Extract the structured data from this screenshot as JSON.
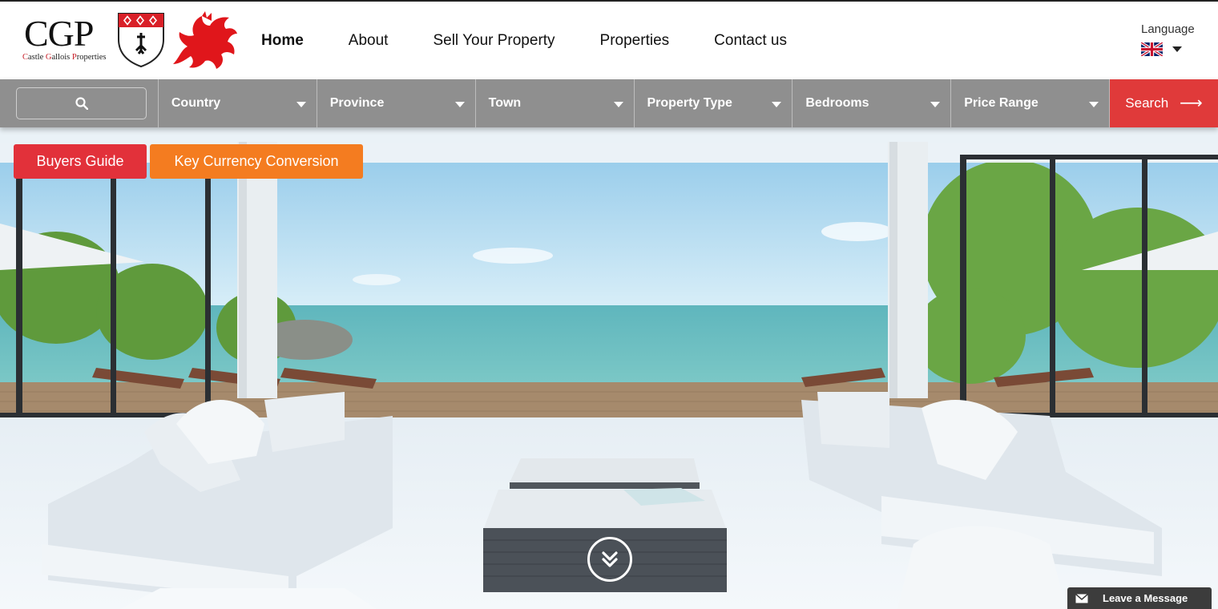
{
  "brand": {
    "logo_text": "CGP",
    "tagline_c1": "C",
    "tagline_part1": "astle ",
    "tagline_g": "G",
    "tagline_part2": "allois ",
    "tagline_p": "P",
    "tagline_part3": "roperties"
  },
  "nav": {
    "items": [
      {
        "label": "Home",
        "active": true
      },
      {
        "label": "About"
      },
      {
        "label": "Sell Your Property"
      },
      {
        "label": "Properties"
      },
      {
        "label": "Contact us"
      }
    ]
  },
  "language": {
    "label": "Language",
    "selected_flag": "uk-flag-icon"
  },
  "search": {
    "keyword_icon": "search-icon",
    "filters": [
      {
        "label": "Country"
      },
      {
        "label": "Province"
      },
      {
        "label": "Town"
      },
      {
        "label": "Property Type"
      },
      {
        "label": "Bedrooms"
      },
      {
        "label": "Price Range"
      }
    ],
    "button_label": "Search",
    "button_icon": "arrow-right-icon"
  },
  "hero": {
    "buttons": [
      {
        "label": "Buyers Guide"
      },
      {
        "label": "Key Currency Conversion"
      }
    ],
    "scroll_icon": "chevron-double-down-icon"
  },
  "chat": {
    "label": "Leave a Message",
    "icon": "envelope-icon"
  },
  "colors": {
    "search_bar": "#8f8f8f",
    "search_button": "#e03a3a",
    "buyers_guide": "#e2313a",
    "currency": "#f47c20",
    "chat": "#3c3c3c"
  }
}
